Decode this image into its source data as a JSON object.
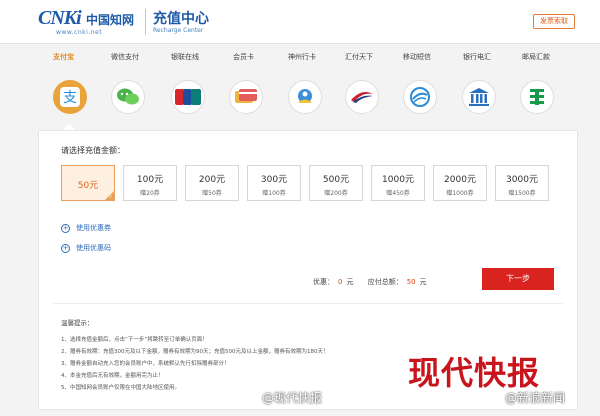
{
  "header": {
    "logo_main": "CNKi",
    "logo_cn": "中国知网",
    "logo_url": "www.cnki.net",
    "title": "充值中心",
    "subtitle": "Recharge Center",
    "invoice_label": "发票索取"
  },
  "tabs": [
    "支付宝",
    "微信支付",
    "银联在线",
    "会员卡",
    "神州行卡",
    "汇付天下",
    "移动短信",
    "银行电汇",
    "邮局汇款"
  ],
  "icons": [
    "alipay-icon",
    "wechat-icon",
    "unionpay-icon",
    "member-card-icon",
    "shenzhouxing-icon",
    "huifu-icon",
    "china-mobile-icon",
    "bank-icon",
    "post-office-icon"
  ],
  "panel": {
    "select_label": "请选择充值金额：",
    "amounts": [
      {
        "value": "50元",
        "gift": ""
      },
      {
        "value": "100元",
        "gift": "赠20券"
      },
      {
        "value": "200元",
        "gift": "赠50券"
      },
      {
        "value": "300元",
        "gift": "赠100券"
      },
      {
        "value": "500元",
        "gift": "赠200券"
      },
      {
        "value": "1000元",
        "gift": "赠450券"
      },
      {
        "value": "2000元",
        "gift": "赠1000券"
      },
      {
        "value": "3000元",
        "gift": "赠1500券"
      }
    ],
    "coupon_label": "使用优惠券",
    "code_label": "使用优惠码",
    "discount_label": "优惠：",
    "discount_value": "0",
    "discount_unit": "元",
    "total_label": "应付总额：",
    "total_value": "50",
    "total_unit": "元",
    "next_label": "下一步"
  },
  "notes": {
    "title": "温馨提示：",
    "items": [
      "1、选择充值金额后，点击“下一步”将跳转至订单确认页面！",
      "2、赠券有效期：充值300元及以下金额，赠券有效期为90天；充值500元及以上金额，赠券有效期为180天！",
      "3、赠券金额自动充入您的会员账户中，系统默认先行扣除赠券部分！",
      "4、本金充值后无有效期，金额用完为止！",
      "5、中国知网会员账户仅限在中国大陆地区使用。"
    ]
  },
  "watermark": {
    "big": "现代快报",
    "weibo1": "@现代快报",
    "weibo2": "@新浪新闻"
  },
  "colors": {
    "brand_blue": "#1e5aa8",
    "accent_orange": "#e8a33a",
    "next_red": "#d8231e"
  }
}
